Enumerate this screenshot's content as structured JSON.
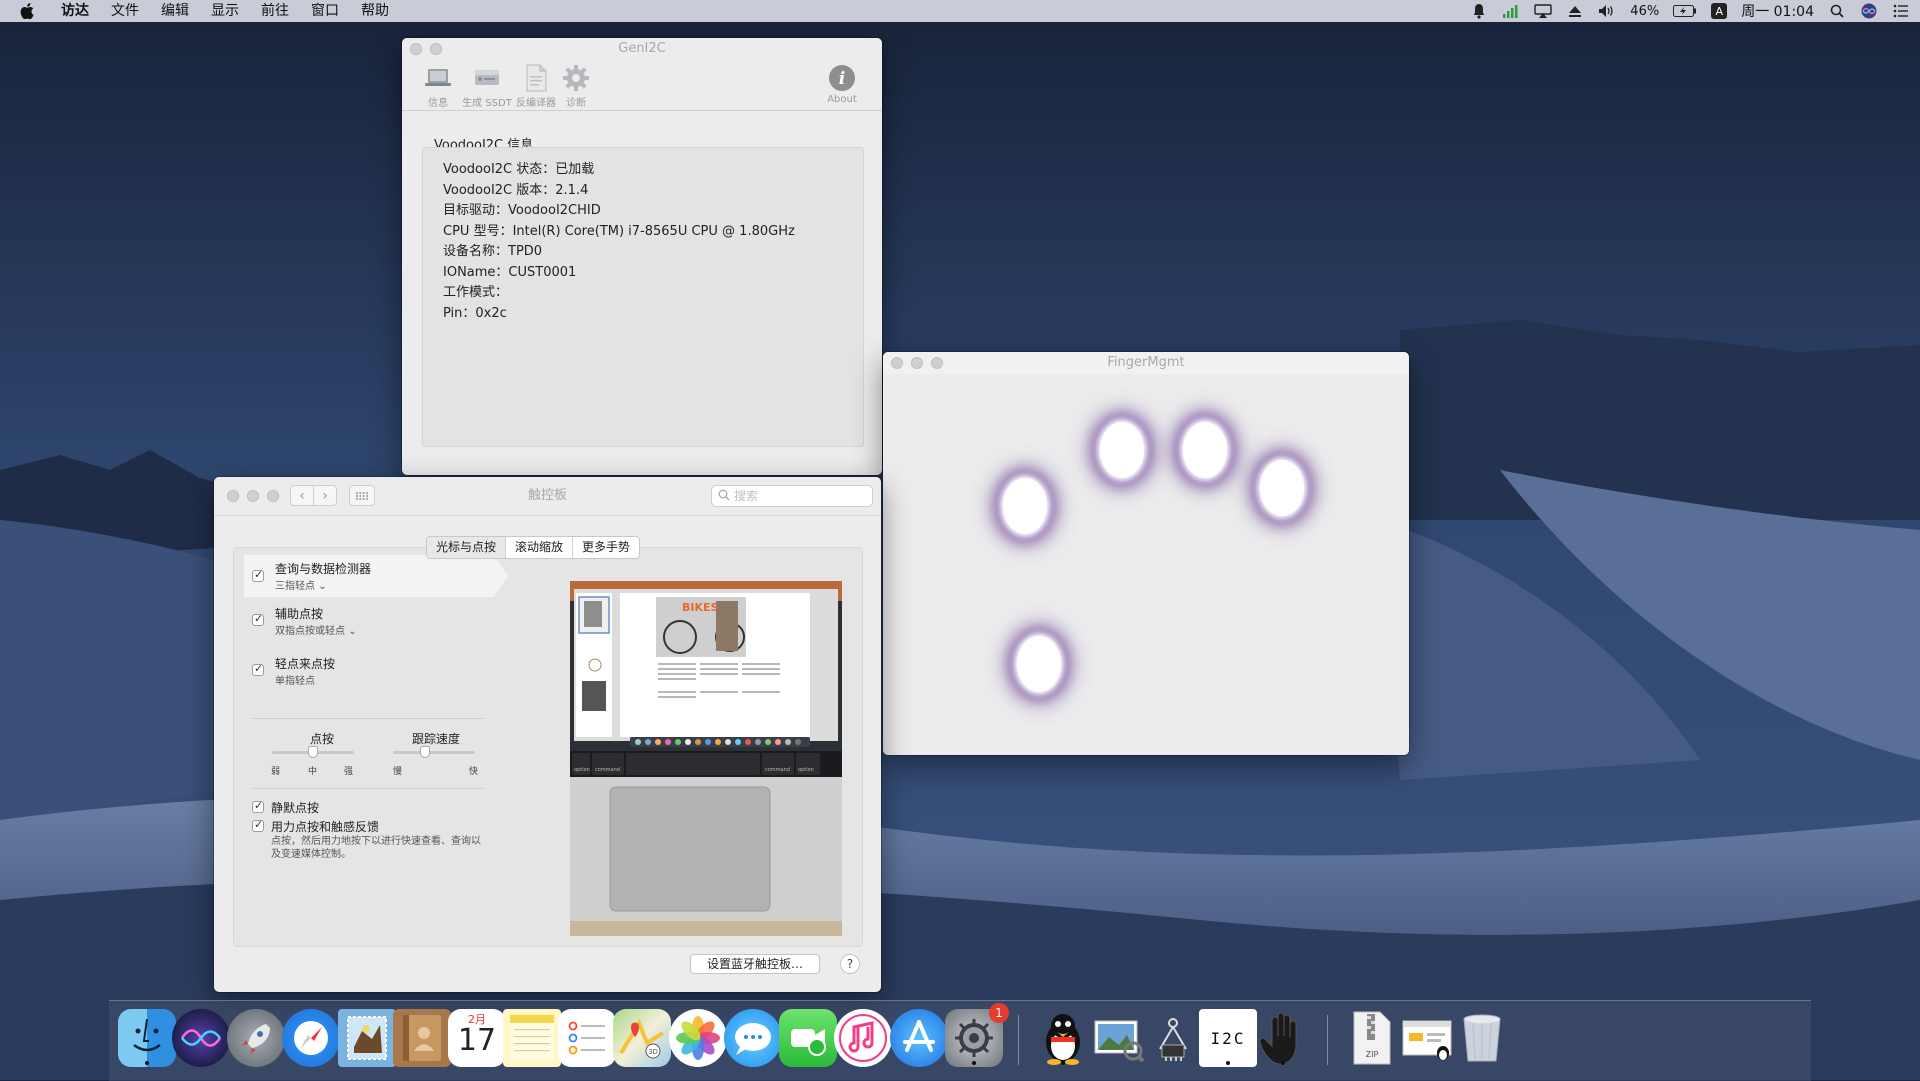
{
  "menubar": {
    "app_name": "访达",
    "items": [
      "文件",
      "编辑",
      "显示",
      "前往",
      "窗口",
      "帮助"
    ],
    "battery": "46%",
    "input_method": "A",
    "clock": "周一 01:04"
  },
  "geni2c": {
    "title": "GenI2C",
    "toolbar": {
      "info": "信息",
      "ssdt": "生成 SSDT",
      "decompiler": "反编译器",
      "diagnose": "诊断",
      "about": "About"
    },
    "section_title": "VoodooI2C 信息",
    "info_lines": [
      "VoodooI2C 状态：已加载",
      "VoodooI2C 版本：2.1.4",
      "目标驱动：VoodooI2CHID",
      "CPU 型号：Intel(R) Core(TM) i7-8565U CPU @ 1.80GHz",
      "设备名称：TPD0",
      "IOName：CUST0001",
      "工作模式：",
      "Pin：0x2c"
    ]
  },
  "fingermgmt": {
    "title": "FingerMgmt"
  },
  "trackpad": {
    "title": "触控板",
    "search_placeholder": "搜索",
    "tabs": [
      "光标与点按",
      "滚动缩放",
      "更多手势"
    ],
    "options": [
      {
        "title": "查询与数据检测器",
        "sub": "三指轻点",
        "checked": true
      },
      {
        "title": "辅助点按",
        "sub": "双指点按或轻点",
        "checked": true
      },
      {
        "title": "轻点来点按",
        "sub": "单指轻点",
        "checked": true
      }
    ],
    "click_slider": {
      "label": "点按",
      "ticks": [
        "弱",
        "中",
        "强"
      ],
      "value": 0.5
    },
    "speed_slider": {
      "label": "跟踪速度",
      "ticks": [
        "慢",
        "快"
      ],
      "value": 0.35
    },
    "silent_click": "静默点按",
    "force_click": "用力点按和触感反馈",
    "force_click_desc": "点按，然后用力地按下以进行快速查看、查询以及变速媒体控制。",
    "bluetooth_button": "设置蓝牙触控板…",
    "help": "?",
    "preview_title_text": "BIKES",
    "keys": [
      "option",
      "command",
      "command",
      "option"
    ]
  },
  "dock": {
    "calendar_month": "2月",
    "calendar_day": "17",
    "sysprefs_badge": "1",
    "i2c_label": "I2C",
    "zip_label": "ZIP"
  }
}
